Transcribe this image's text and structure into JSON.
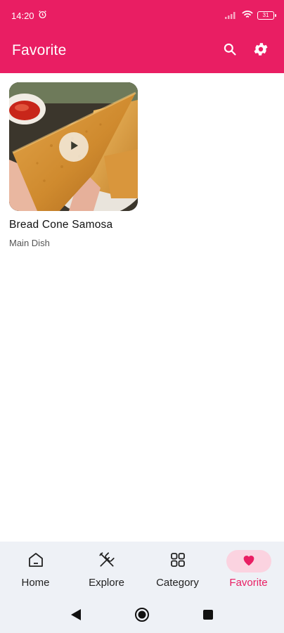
{
  "status": {
    "time": "14:20",
    "battery": "31"
  },
  "appbar": {
    "title": "Favorite",
    "color": "#e91e63",
    "actions": [
      "search-icon",
      "gear-icon"
    ]
  },
  "favorites": [
    {
      "title": "Bread Cone Samosa",
      "category": "Main Dish",
      "has_video": true
    }
  ],
  "bottom_nav": {
    "items": [
      {
        "label": "Home",
        "icon": "home-icon"
      },
      {
        "label": "Explore",
        "icon": "utensils-icon"
      },
      {
        "label": "Category",
        "icon": "grid-icon"
      },
      {
        "label": "Favorite",
        "icon": "heart-icon",
        "active": true
      }
    ],
    "active_color": "#e91e63"
  },
  "system_nav": [
    "back-icon",
    "home-circle-icon",
    "recents-icon"
  ]
}
